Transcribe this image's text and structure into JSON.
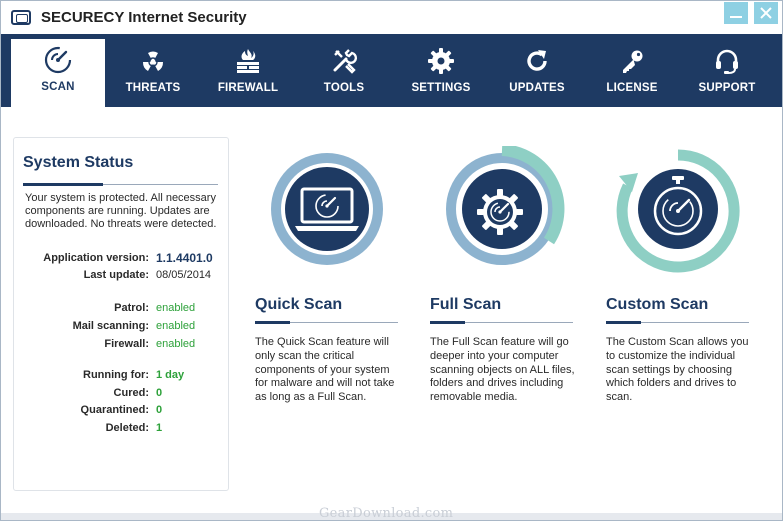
{
  "app": {
    "title": "SECURECY Internet Security",
    "icon": "monitor-icon"
  },
  "window_controls": {
    "minimize_icon": "minimize-icon",
    "close_icon": "close-icon",
    "accent": "#8ed0e3"
  },
  "nav": {
    "items": [
      {
        "label": "SCAN",
        "icon": "radar-icon",
        "active": true
      },
      {
        "label": "THREATS",
        "icon": "radiation-icon",
        "active": false
      },
      {
        "label": "FIREWALL",
        "icon": "firewall-icon",
        "active": false
      },
      {
        "label": "TOOLS",
        "icon": "tools-icon",
        "active": false
      },
      {
        "label": "SETTINGS",
        "icon": "gear-icon",
        "active": false
      },
      {
        "label": "UPDATES",
        "icon": "refresh-icon",
        "active": false
      },
      {
        "label": "LICENSE",
        "icon": "key-icon",
        "active": false
      },
      {
        "label": "SUPPORT",
        "icon": "headset-icon",
        "active": false
      }
    ]
  },
  "status": {
    "title": "System Status",
    "description": "Your system is protected. All necessary components are running. Updates are downloaded. No threats were detected.",
    "app_version_label": "Application version:",
    "app_version_value": "1.1.4401.0",
    "last_update_label": "Last update:",
    "last_update_value": "08/05/2014",
    "patrol_label": "Patrol:",
    "patrol_value": "enabled",
    "mail_label": "Mail scanning:",
    "mail_value": "enabled",
    "firewall_label": "Firewall:",
    "firewall_value": "enabled",
    "running_label": "Running for:",
    "running_value": "1 day",
    "cured_label": "Cured:",
    "cured_value": "0",
    "quarantined_label": "Quarantined:",
    "quarantined_value": "0",
    "deleted_label": "Deleted:",
    "deleted_value": "1"
  },
  "scans": [
    {
      "title": "Quick Scan",
      "description": "The Quick Scan feature will only scan the critical components of your system for malware and will not take as long as a Full Scan.",
      "icon": "laptop-radar-icon"
    },
    {
      "title": "Full Scan",
      "description": "The Full Scan feature will go deeper into your computer scanning objects on ALL files, folders and drives including removable media.",
      "icon": "gear-radar-icon"
    },
    {
      "title": "Custom Scan",
      "description": "The Custom Scan allows you to customize the individual scan settings by choosing which folders and drives to scan.",
      "icon": "stopwatch-radar-icon"
    }
  ],
  "colors": {
    "navy": "#1e3a63",
    "steel_blue": "#8db3cf",
    "teal": "#8ecfc4",
    "green": "#2da13a"
  },
  "watermark": "GearDownload.com"
}
